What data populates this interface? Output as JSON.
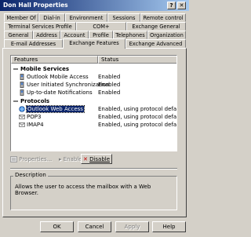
{
  "window": {
    "title": "Don Hall Properties",
    "help_btn": "?",
    "close_btn": "✕"
  },
  "tabs": {
    "row1": [
      "Member Of",
      "Dial-in",
      "Environment",
      "Sessions",
      "Remote control"
    ],
    "row2": [
      "Terminal Services Profile",
      "COM+",
      "Exchange General"
    ],
    "row3": [
      "General",
      "Address",
      "Account",
      "Profile",
      "Telephones",
      "Organization"
    ],
    "row4": [
      "E-mail Addresses",
      "Exchange Features",
      "Exchange Advanced"
    ],
    "active": "Exchange Features"
  },
  "list": {
    "columns": [
      "Features",
      "Status"
    ],
    "groups": [
      {
        "label": "Mobile Services",
        "items": [
          {
            "name": "Outlook Mobile Access",
            "status": "Enabled"
          },
          {
            "name": "User Initiated Synchronization",
            "status": "Enabled"
          },
          {
            "name": "Up-to-date Notifications",
            "status": "Enabled"
          }
        ]
      },
      {
        "label": "Protocols",
        "items": [
          {
            "name": "Outlook Web Access",
            "status": "Enabled, using protocol defaults.",
            "selected": true
          },
          {
            "name": "POP3",
            "status": "Enabled, using protocol defaults."
          },
          {
            "name": "IMAP4",
            "status": "Enabled, using protocol defaults."
          }
        ]
      }
    ]
  },
  "actions": {
    "properties": "Properties...",
    "enable": "Enable",
    "disable": "Disable"
  },
  "description": {
    "title": "Description",
    "text": "Allows the user to access the mailbox with a Web Browser."
  },
  "buttons": {
    "ok": "OK",
    "cancel": "Cancel",
    "apply": "Apply",
    "help": "Help"
  },
  "colors": {
    "selection": "#0a246a",
    "titlebar": "#0a246a",
    "face": "#d4d0c8"
  }
}
